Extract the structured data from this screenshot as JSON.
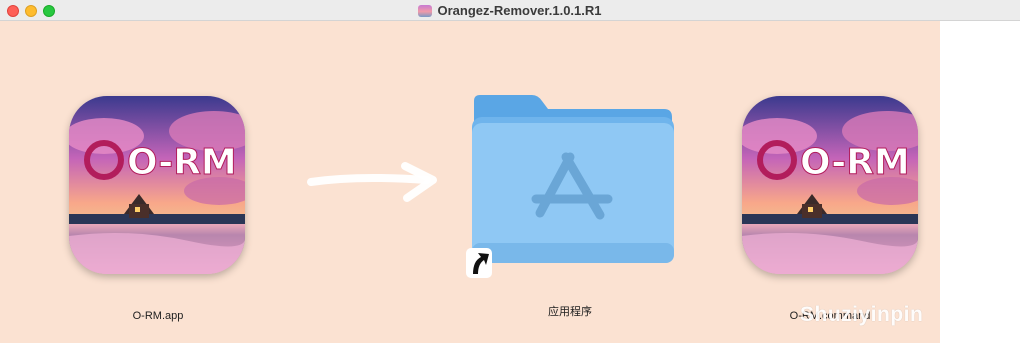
{
  "window": {
    "title": "Orangez-Remover.1.0.1.R1"
  },
  "items": [
    {
      "label": "O-RM.app",
      "icon_text": "O-RM"
    },
    {
      "label": "应用程序"
    },
    {
      "label": "O-RM.command",
      "icon_text": "O-RM"
    }
  ],
  "watermark": "Shuziyinpin",
  "icons": {
    "arrow": "arrow-right-icon",
    "folder": "applications-folder-icon",
    "alias": "alias-arrow-icon"
  },
  "colors": {
    "background": "#fbe2d2",
    "folder": "#8fc8f4",
    "arrow": "#ffffff"
  }
}
